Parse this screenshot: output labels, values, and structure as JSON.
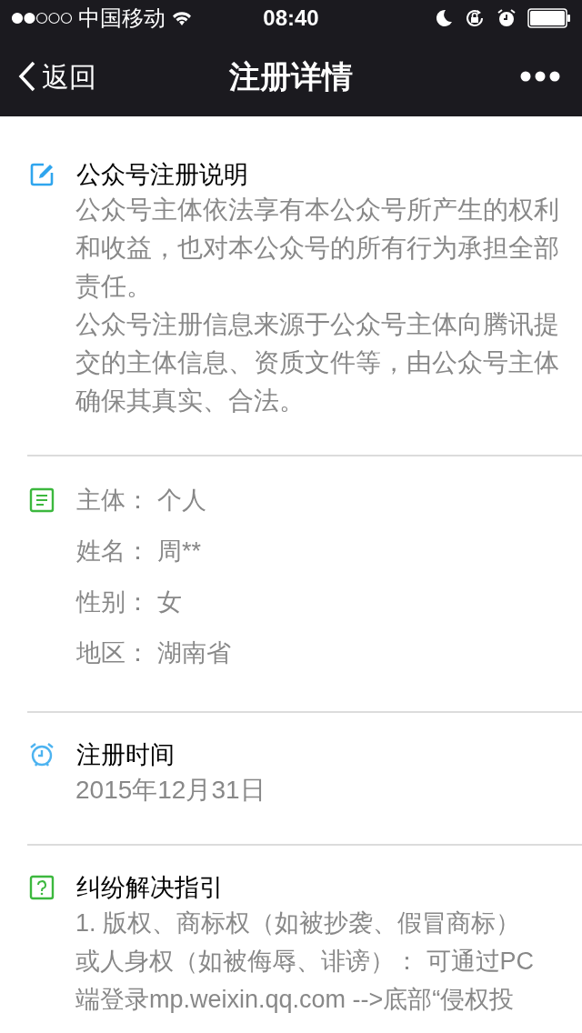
{
  "status_bar": {
    "carrier": "中国移动",
    "time": "08:40"
  },
  "nav": {
    "back": "返回",
    "title": "注册详情"
  },
  "sections": [
    {
      "kind": "notice",
      "title": "公众号注册说明",
      "paragraphs": [
        "公众号主体依法享有本公众号所产生的权利和收益，也对本公众号的所有行为承担全部责任。",
        "公众号注册信息来源于公众号主体向腾讯提交的主体信息、资质文件等，由公众号主体确保其真实、合法。"
      ]
    },
    {
      "kind": "info",
      "rows": [
        {
          "label": "主体：",
          "value": "个人"
        },
        {
          "label": "姓名：",
          "value": "周**"
        },
        {
          "label": "性别：",
          "value": "女"
        },
        {
          "label": "地区：",
          "value": "湖南省"
        }
      ]
    },
    {
      "kind": "time",
      "title": "注册时间",
      "paragraphs": [
        "2015年12月31日"
      ]
    },
    {
      "kind": "guide",
      "title": "纠纷解决指引",
      "lines": [
        "1. 版权、商标权（如被抄袭、假冒商标）",
        "或人身权（如被侮辱、诽谤）： 可通过PC",
        "端登录mp.weixin.qq.com -->底部“侵权投"
      ]
    }
  ]
}
